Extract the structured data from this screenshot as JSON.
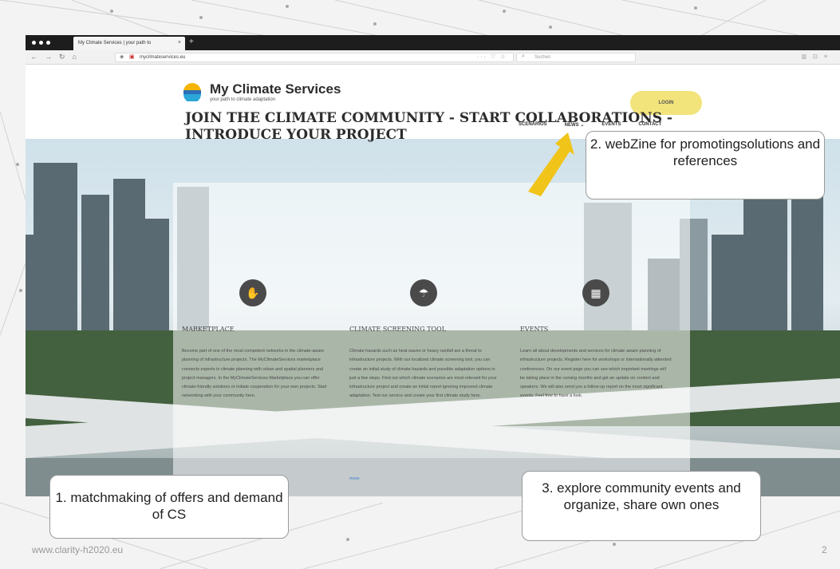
{
  "browser": {
    "tab_title": "My Climate Services | your path to",
    "tab_close": "×",
    "new_tab": "+",
    "url": "mycilmateservices.eu",
    "url_actions": "··· ♡ ☆",
    "search_placeholder": "Suchen"
  },
  "site": {
    "logo_title": "My Climate Services",
    "logo_subtitle": "your path to climate adaptation",
    "login_label": "LOGIN",
    "nav": [
      "SCENARIOS",
      "NEWS ⌄",
      "EVENTS",
      "CONTACT"
    ],
    "hero_title": "JOIN THE CLIMATE COMMUNITY - START COLLABORATIONS - INTRODUCE YOUR PROJECT",
    "features": [
      {
        "icon": "handshake-icon",
        "title": "MARKETPLACE",
        "body": "Become part of one of the most competent networks in the climate-aware planning of infrastructure projects. The MyClimateServices marketplace connects experts in climate planning with urban and spatial planners and project managers. In the MyClimateServices Marketplace you can offer climate-friendly solutions or initiate cooperation for your own projects. Start networking with your community here."
      },
      {
        "icon": "umbrella-icon",
        "title": "CLIMATE SCREENING TOOL",
        "body": "Climate hazards such as heat waves or heavy rainfall are a threat to infrastructure projects. With our localized climate screening tool, you can create an initial study of climate hazards and possible adaptation options in just a few steps. Find out which climate scenarios are most relevant for your infrastructure project and create an initial report ignoring improved climate adaptation. Test our service and create your first climate study here.",
        "link": "more"
      },
      {
        "icon": "calendar-icon",
        "title": "EVENTS",
        "body": "Learn all about developments and services for climate aware planning of infrastructure projects. Register here for workshops or internationally attended conferences. On our event page you can see which important meetings will be taking place in the coming months and get an update on content and speakers. We will also send you a follow-up report on the most significant events. Feel free to have a look."
      }
    ]
  },
  "callouts": {
    "webzine": "2. webZine for promotingsolutions  and references",
    "matchmaking": "1. matchmaking  of offers and demand  of CS",
    "explore": "3. explore community events and organize, share own ones"
  },
  "slide": {
    "footer_url": "www.clarity-h2020.eu",
    "page_number": "2"
  },
  "colors": {
    "login_pill": "#f2e37b",
    "arrow": "#f0c419",
    "feature_icon_bg": "#4a4a4a"
  }
}
